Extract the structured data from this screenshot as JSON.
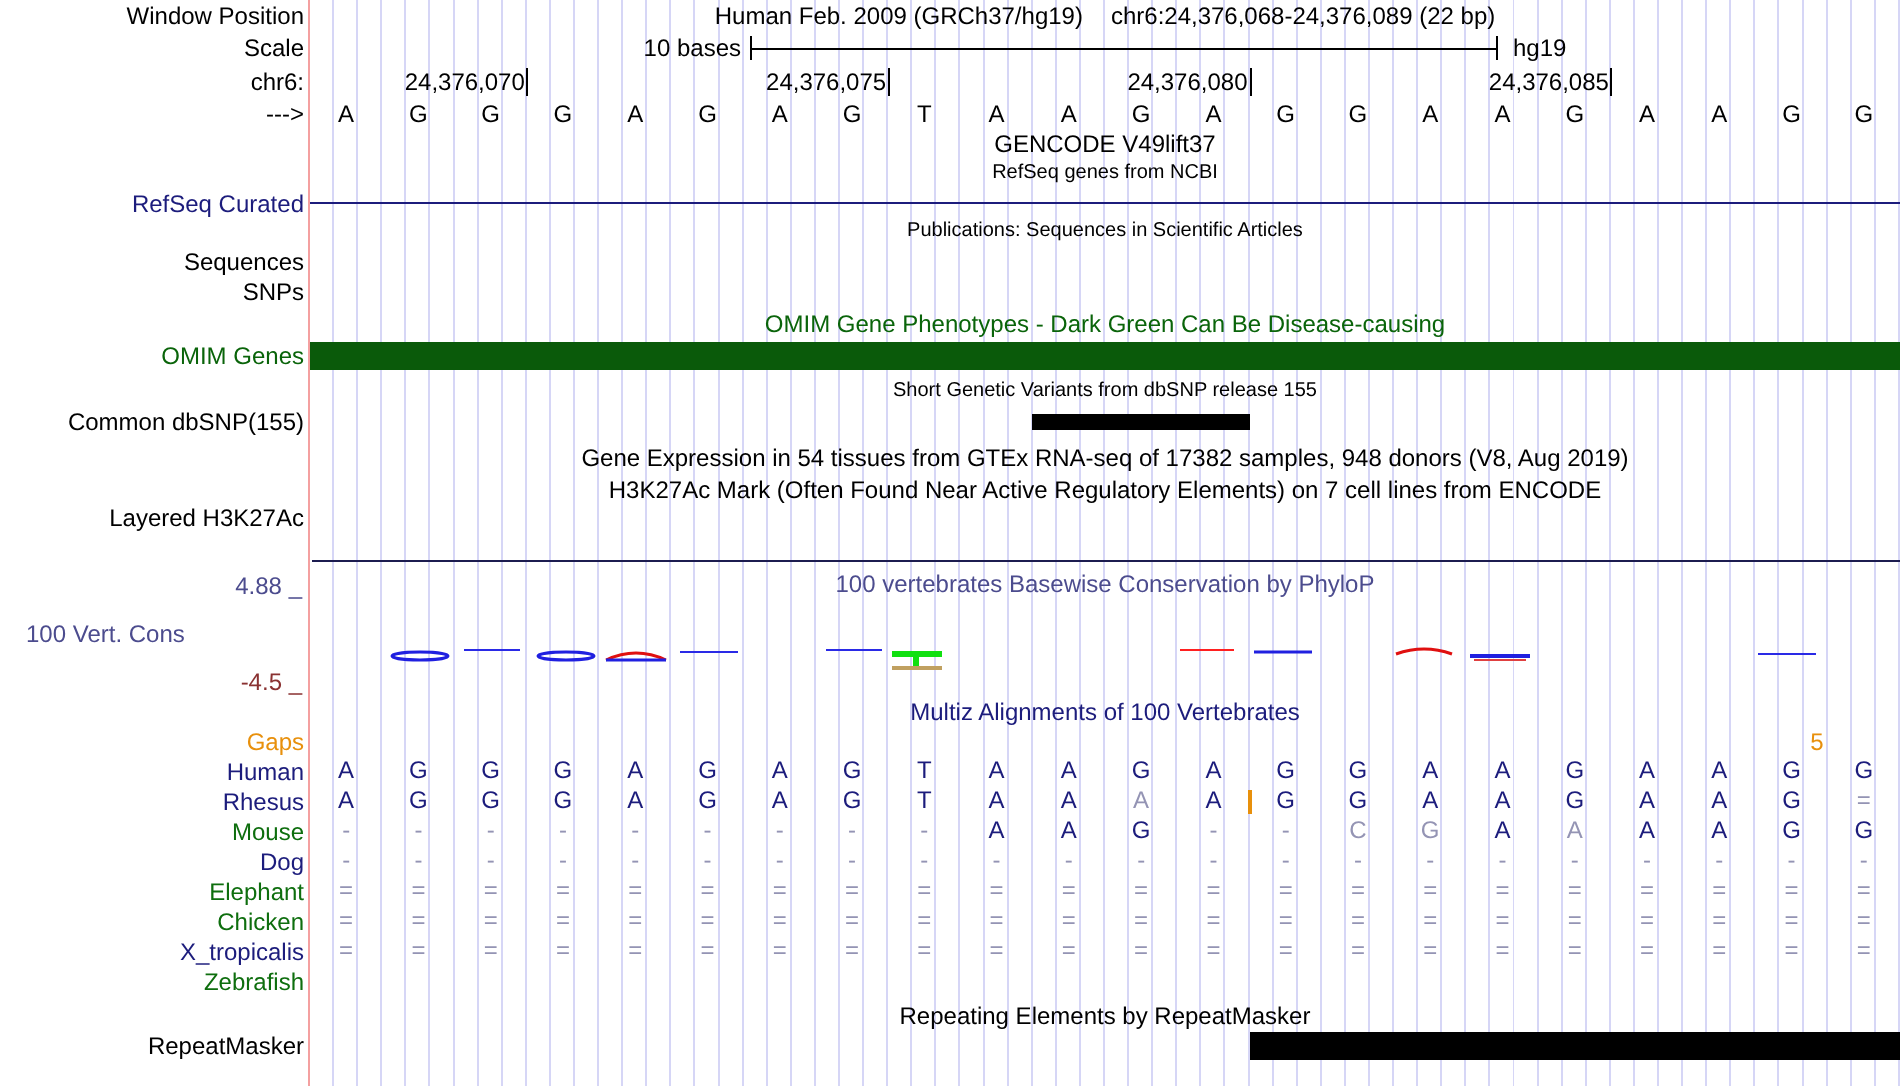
{
  "window_position": {
    "label": "Window Position",
    "assembly": "Human Feb. 2009 (GRCh37/hg19)",
    "range": "chr6:24,376,068-24,376,089 (22 bp)"
  },
  "scale": {
    "label": "Scale",
    "length": "10 bases",
    "assembly": "hg19"
  },
  "ruler": {
    "label": "chr6:",
    "ticks": [
      "24,376,070",
      "24,376,075",
      "24,376,080",
      "24,376,085"
    ]
  },
  "bases": {
    "label": "--->",
    "sequence": [
      "A",
      "G",
      "G",
      "G",
      "A",
      "G",
      "A",
      "G",
      "T",
      "A",
      "A",
      "G",
      "A",
      "G",
      "G",
      "A",
      "A",
      "G",
      "A",
      "A",
      "G",
      "G"
    ]
  },
  "gencode": {
    "title": "GENCODE V49lift37"
  },
  "refseq": {
    "subtitle": "RefSeq genes from NCBI",
    "label": "RefSeq Curated"
  },
  "publications": {
    "title": "Publications: Sequences in Scientific Articles",
    "label": "Sequences"
  },
  "snps": {
    "label": "SNPs"
  },
  "omim": {
    "title": "OMIM Gene Phenotypes - Dark Green Can Be Disease-causing",
    "label": "OMIM Genes",
    "coverage": [
      true,
      true,
      true,
      true,
      true,
      true,
      true,
      true,
      true,
      true,
      true,
      true,
      true,
      true,
      true,
      true,
      true,
      true,
      true,
      true,
      true,
      true
    ]
  },
  "dbsnp": {
    "title": "Short Genetic Variants from dbSNP release 155",
    "label": "Common dbSNP(155)",
    "coverage": [
      false,
      false,
      false,
      false,
      false,
      false,
      false,
      false,
      false,
      false,
      true,
      true,
      true,
      false,
      false,
      false,
      false,
      false,
      false,
      false,
      false,
      false
    ]
  },
  "gtex": {
    "title": "Gene Expression in 54 tissues from GTEx RNA-seq of 17382 samples, 948 donors (V8, Aug 2019)"
  },
  "h3k27ac": {
    "title": "H3K27Ac Mark (Often Found Near Active Regulatory Elements) on 7 cell lines from ENCODE",
    "label": "Layered H3K27Ac"
  },
  "phylop": {
    "title": "100 vertebrates Basewise Conservation by PhyloP",
    "label": "100 Vert. Cons",
    "max": "4.88 _",
    "min": "-4.5 _"
  },
  "multiz": {
    "title": "Multiz Alignments of 100 Vertebrates",
    "gaps_label": "Gaps",
    "gap_count": "5",
    "species": [
      {
        "name": "Human",
        "color": "#1c1c7c",
        "bases": [
          "A",
          "G",
          "G",
          "G",
          "A",
          "G",
          "A",
          "G",
          "T",
          "A",
          "A",
          "G",
          "A",
          "G",
          "G",
          "A",
          "A",
          "G",
          "A",
          "A",
          "G",
          "G"
        ]
      },
      {
        "name": "Rhesus",
        "color": "#1c1c7c",
        "bases": [
          "A",
          "G",
          "G",
          "G",
          "A",
          "G",
          "A",
          "G",
          "T",
          "A",
          "A",
          "A",
          "A",
          "G",
          "G",
          "A",
          "A",
          "G",
          "A",
          "A",
          "G",
          "="
        ],
        "insertions": [
          false,
          false,
          false,
          false,
          false,
          false,
          false,
          false,
          false,
          false,
          false,
          false,
          false,
          true,
          false,
          false,
          false,
          false,
          false,
          false,
          false,
          false
        ]
      },
      {
        "name": "Mouse",
        "color": "#0e6e0e",
        "bases": [
          "-",
          "-",
          "-",
          "-",
          "-",
          "-",
          "-",
          "-",
          "-",
          "A",
          "A",
          "G",
          "-",
          "-",
          "C",
          "G",
          "A",
          "A",
          "A",
          "A",
          "G",
          "G"
        ]
      },
      {
        "name": "Dog",
        "color": "#1c1c7c",
        "bases": [
          "-",
          "-",
          "-",
          "-",
          "-",
          "-",
          "-",
          "-",
          "-",
          "-",
          "-",
          "-",
          "-",
          "-",
          "-",
          "-",
          "-",
          "-",
          "-",
          "-",
          "-",
          "-"
        ]
      },
      {
        "name": "Elephant",
        "color": "#0e6e0e",
        "bases": [
          "=",
          "=",
          "=",
          "=",
          "=",
          "=",
          "=",
          "=",
          "=",
          "=",
          "=",
          "=",
          "=",
          "=",
          "=",
          "=",
          "=",
          "=",
          "=",
          "=",
          "=",
          "="
        ]
      },
      {
        "name": "Chicken",
        "color": "#0e6e0e",
        "bases": [
          "=",
          "=",
          "=",
          "=",
          "=",
          "=",
          "=",
          "=",
          "=",
          "=",
          "=",
          "=",
          "=",
          "=",
          "=",
          "=",
          "=",
          "=",
          "=",
          "=",
          "=",
          "="
        ]
      },
      {
        "name": "X_tropicalis",
        "color": "#1c1c7c",
        "bases": [
          "=",
          "=",
          "=",
          "=",
          "=",
          "=",
          "=",
          "=",
          "=",
          "=",
          "=",
          "=",
          "=",
          "=",
          "=",
          "=",
          "=",
          "=",
          "=",
          "=",
          "=",
          "="
        ]
      },
      {
        "name": "Zebrafish",
        "color": "#0e6e0e"
      }
    ]
  },
  "repeatmasker": {
    "title": "Repeating Elements by RepeatMasker",
    "label": "RepeatMasker",
    "coverage": [
      false,
      false,
      false,
      false,
      false,
      false,
      false,
      false,
      false,
      false,
      false,
      false,
      false,
      true,
      true,
      true,
      true,
      true,
      true,
      true,
      true,
      true
    ]
  }
}
